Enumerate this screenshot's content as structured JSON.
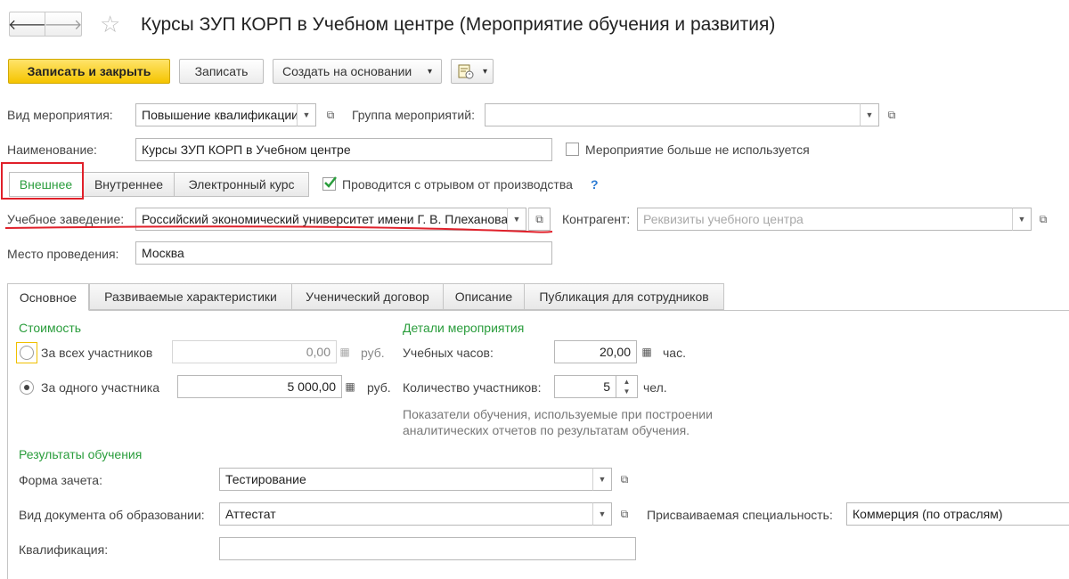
{
  "window": {
    "title": "Курсы ЗУП КОРП в Учебном центре (Мероприятие обучения и развития)",
    "nav_back": "🡐",
    "nav_forward": "🡒",
    "star": "☆"
  },
  "toolbar": {
    "save_close": "Записать и закрыть",
    "save": "Записать",
    "create_based": "Создать на основании",
    "caret": "▾"
  },
  "form": {
    "event_type_label": "Вид мероприятия:",
    "event_type_value": "Повышение квалификации",
    "event_group_label": "Группа мероприятий:",
    "event_group_value": "",
    "name_label": "Наименование:",
    "name_value": "Курсы ЗУП КОРП в Учебном центре",
    "not_used_label": "Мероприятие больше не используется",
    "not_used_checked": false,
    "kind_tabs": [
      "Внешнее",
      "Внутреннее",
      "Электронный курс"
    ],
    "kind_active": 0,
    "off_job_label": "Проводится с отрывом от производства",
    "off_job_checked": true,
    "help": "?",
    "institution_label": "Учебное заведение:",
    "institution_value": "Российский экономический университет имени Г. В. Плеханова",
    "counterparty_label": "Контрагент:",
    "counterparty_placeholder": "Реквизиты учебного центра",
    "place_label": "Место проведения:",
    "place_value": "Москва"
  },
  "tabs": [
    "Основное",
    "Развиваемые характеристики",
    "Ученический договор",
    "Описание",
    "Публикация для сотрудников"
  ],
  "tab_active": 0,
  "cost": {
    "header": "Стоимость",
    "all_label": "За всех участников",
    "all_value": "0,00",
    "one_label": "За одного участника",
    "one_value": "5 000,00",
    "unit": "руб.",
    "selected": "one"
  },
  "details": {
    "header": "Детали мероприятия",
    "hours_label": "Учебных часов:",
    "hours_value": "20,00",
    "hours_unit": "час.",
    "participants_label": "Количество участников:",
    "participants_value": "5",
    "participants_unit": "чел.",
    "note_line1": "Показатели обучения, используемые при построении",
    "note_line2": "аналитических отчетов по результатам обучения."
  },
  "results": {
    "header": "Результаты обучения",
    "form_label": "Форма зачета:",
    "form_value": "Тестирование",
    "doc_label": "Вид документа об образовании:",
    "doc_value": "Аттестат",
    "specialty_label": "Присваиваемая специальность:",
    "specialty_value": "Коммерция (по отраслям)",
    "qualification_label": "Квалификация:",
    "qualification_value": ""
  },
  "colors": {
    "accent_green": "#2a9d3c",
    "primary_yellow": "#f5c400",
    "annotation_red": "#e0202a"
  }
}
